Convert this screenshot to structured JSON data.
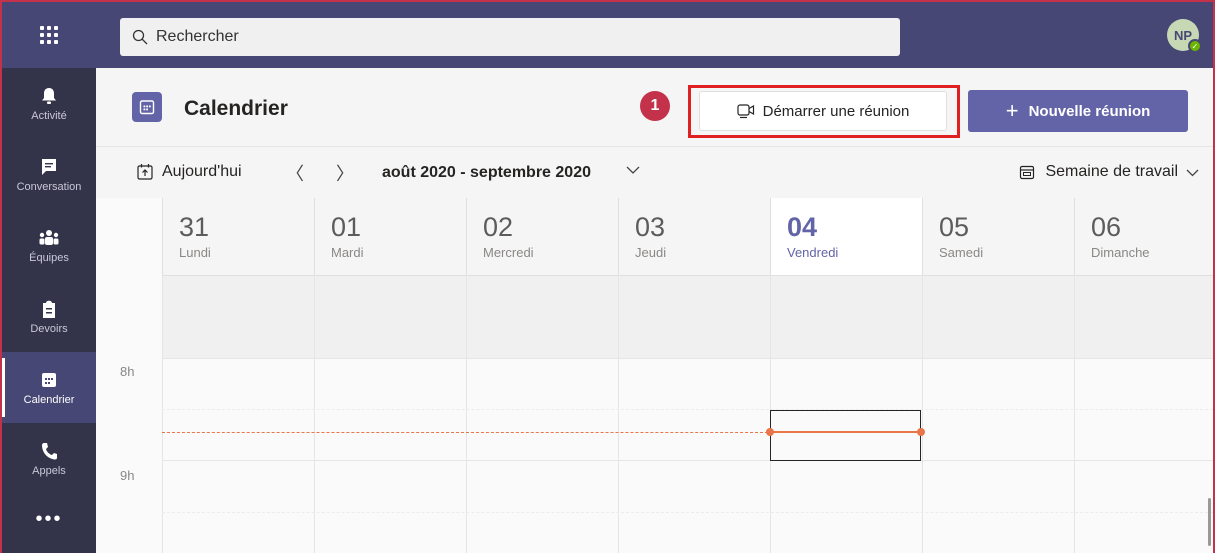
{
  "topbar": {
    "search_placeholder": "Rechercher",
    "avatar_initials": "NP"
  },
  "rail": {
    "items": [
      {
        "label": "Activité",
        "icon": "bell-icon"
      },
      {
        "label": "Conversation",
        "icon": "chat-icon"
      },
      {
        "label": "Équipes",
        "icon": "teams-icon"
      },
      {
        "label": "Devoirs",
        "icon": "assignments-icon"
      },
      {
        "label": "Calendrier",
        "icon": "calendar-icon",
        "active": true
      },
      {
        "label": "Appels",
        "icon": "phone-icon"
      }
    ],
    "more": "•••"
  },
  "header": {
    "title": "Calendrier",
    "step_number": "1",
    "start_meeting_label": "Démarrer une réunion",
    "new_meeting_label": "Nouvelle réunion"
  },
  "toolbar": {
    "today_label": "Aujourd'hui",
    "prev": "〈",
    "next": "〉",
    "date_range": "août 2020 - septembre 2020",
    "view_label": "Semaine de travail"
  },
  "days": [
    {
      "num": "31",
      "name": "Lundi"
    },
    {
      "num": "01",
      "name": "Mardi"
    },
    {
      "num": "02",
      "name": "Mercredi"
    },
    {
      "num": "03",
      "name": "Jeudi"
    },
    {
      "num": "04",
      "name": "Vendredi",
      "today": true
    },
    {
      "num": "05",
      "name": "Samedi"
    },
    {
      "num": "06",
      "name": "Dimanche"
    }
  ],
  "hours": [
    "8h",
    "9h"
  ],
  "colors": {
    "brand": "#6264a7",
    "rail": "#33344a",
    "topbar": "#464775",
    "now_indicator": "#e97548",
    "highlight": "#e02020"
  }
}
